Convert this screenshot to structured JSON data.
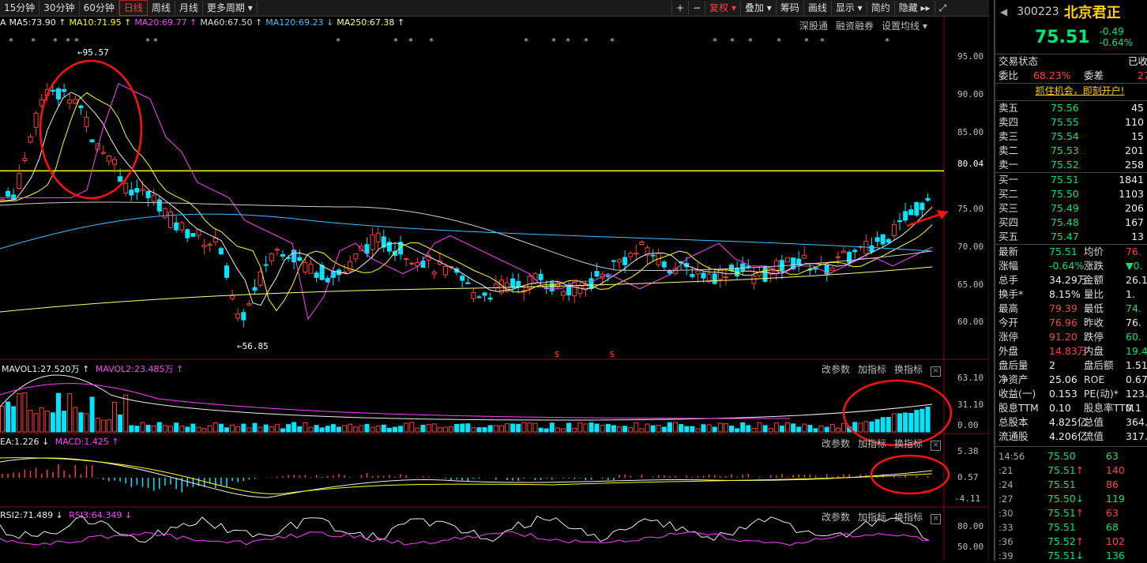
{
  "toolbar": {
    "periods": [
      "15分钟",
      "30分钟",
      "60分钟",
      "日线",
      "周线",
      "月线",
      "更多周期 ▾"
    ],
    "active": "日线",
    "right_items": [
      "+",
      "−",
      "复权 ▾",
      "叠加 ▾",
      "筹码",
      "画线",
      "显示 ▾",
      "简约",
      "隐藏 ▸▸"
    ]
  },
  "ma_legend": {
    "prefix": "A",
    "items": [
      {
        "text": "MA5:73.90 ↑",
        "color": "#eeeeee"
      },
      {
        "text": "MA10:71.95 ↑",
        "color": "#ffff00"
      },
      {
        "text": "MA20:69.77 ↑",
        "color": "#ff40ff"
      },
      {
        "text": "MA60:67.50 ↑",
        "color": "#dddddd"
      },
      {
        "text": "MA120:69.23 ↓",
        "color": "#40c0ff"
      },
      {
        "text": "MA250:67.38 ↑",
        "color": "#ffff80"
      }
    ],
    "links": [
      "深股通",
      "融资融券",
      "设置均线 ▾"
    ]
  },
  "price_chart": {
    "y_ticks": [
      "95.00",
      "90.00",
      "85.00",
      "80.04",
      "75.00",
      "70.00",
      "65.00",
      "60.00"
    ],
    "high_label": "95.57",
    "low_label": "56.85",
    "ref_line": 80.04
  },
  "volume_panel": {
    "title_1": "MAVOL1:27.520万 ↑",
    "title_2": "MAVOL2:23.485万 ↑",
    "links": [
      "改参数",
      "加指标",
      "换指标"
    ],
    "y_ticks": [
      "63.10",
      "31.10",
      "0.00"
    ]
  },
  "macd_panel": {
    "title_1": "EA:1.226 ↓",
    "title_2": "MACD:1.425 ↑",
    "links": [
      "改参数",
      "加指标",
      "换指标"
    ],
    "y_ticks": [
      "5.38",
      "0.57",
      "-4.11"
    ]
  },
  "rsi_panel": {
    "title_1": "RSI2:71.489 ↓",
    "title_2": "RSI3:64.349 ↓",
    "links": [
      "改参数",
      "加指标",
      "换指标"
    ],
    "y_ticks": [
      "80.00",
      "50.00"
    ]
  },
  "quote": {
    "code": "300223",
    "name": "北京君正",
    "price": "75.51",
    "change": "-0.49",
    "change_pct": "-0.64%",
    "status_label": "交易状态",
    "status_value": "已收",
    "weibi_label": "委比",
    "weibi_value": "68.23%",
    "weicha_label": "委差",
    "weicha_value": "27",
    "promo": "抓住机会，即刻开户!",
    "asks": [
      {
        "label": "卖五",
        "price": "75.56",
        "vol": "45"
      },
      {
        "label": "卖四",
        "price": "75.55",
        "vol": "110"
      },
      {
        "label": "卖三",
        "price": "75.54",
        "vol": "15"
      },
      {
        "label": "卖二",
        "price": "75.53",
        "vol": "201"
      },
      {
        "label": "卖一",
        "price": "75.52",
        "vol": "258"
      }
    ],
    "bids": [
      {
        "label": "买一",
        "price": "75.51",
        "vol": "1841"
      },
      {
        "label": "买二",
        "price": "75.50",
        "vol": "1103"
      },
      {
        "label": "买三",
        "price": "75.49",
        "vol": "206"
      },
      {
        "label": "买四",
        "price": "75.48",
        "vol": "167"
      },
      {
        "label": "买五",
        "price": "75.47",
        "vol": "13"
      }
    ],
    "stats": [
      {
        "l1": "最新",
        "v1": "75.51",
        "c1": "green",
        "l2": "均价",
        "v2": "76.",
        "c2": "redc"
      },
      {
        "l1": "涨幅",
        "v1": "-0.64%",
        "c1": "green",
        "l2": "涨跌",
        "v2": "▼0.",
        "c2": "green"
      },
      {
        "l1": "总手",
        "v1": "34.29万",
        "c1": "white",
        "l2": "金额",
        "v2": "26.18",
        "c2": "white"
      },
      {
        "l1": "换手*",
        "v1": "8.15%",
        "c1": "white",
        "l2": "量比",
        "v2": "1.",
        "c2": "white"
      },
      {
        "l1": "最高",
        "v1": "79.39",
        "c1": "redc",
        "l2": "最低",
        "v2": "74.",
        "c2": "green"
      },
      {
        "l1": "今开",
        "v1": "76.96",
        "c1": "redc",
        "l2": "昨收",
        "v2": "76.",
        "c2": "white"
      },
      {
        "l1": "涨停",
        "v1": "91.20",
        "c1": "redc",
        "l2": "跌停",
        "v2": "60.",
        "c2": "green"
      },
      {
        "l1": "外盘",
        "v1": "14.83万",
        "c1": "redc",
        "l2": "内盘",
        "v2": "19.46",
        "c2": "green"
      },
      {
        "l1": "盘后量",
        "v1": "2",
        "c1": "white",
        "l2": "盘后额",
        "v2": "1.51",
        "c2": "white"
      },
      {
        "l1": "净资产",
        "v1": "25.06",
        "c1": "white",
        "l2": "ROE",
        "v2": "0.67",
        "c2": "white"
      },
      {
        "l1": "收益(一)",
        "v1": "0.153",
        "c1": "white",
        "l2": "PE(动)*",
        "v2": "123.",
        "c2": "white"
      },
      {
        "l1": "股息TTM",
        "v1": "0.10",
        "c1": "white",
        "l2": "股息率TTM",
        "v2": "0.1",
        "c2": "white"
      },
      {
        "l1": "总股本",
        "v1": "4.825亿",
        "c1": "white",
        "l2": "总值",
        "v2": "364.4",
        "c2": "white"
      },
      {
        "l1": "流通股",
        "v1": "4.206亿",
        "c1": "white",
        "l2": "流值",
        "v2": "317.6",
        "c2": "white"
      }
    ],
    "ticks": [
      {
        "time": "14:56",
        "price": "75.50",
        "vol": "63",
        "pc": "green",
        "vc": "green",
        "arrow": ""
      },
      {
        "time": ":21",
        "price": "75.51",
        "vol": "140",
        "pc": "green",
        "vc": "redc",
        "arrow": "↑"
      },
      {
        "time": ":24",
        "price": "75.51",
        "vol": "86",
        "pc": "green",
        "vc": "redc",
        "arrow": ""
      },
      {
        "time": ":27",
        "price": "75.50",
        "vol": "119",
        "pc": "green",
        "vc": "green",
        "arrow": "↓"
      },
      {
        "time": ":30",
        "price": "75.51",
        "vol": "63",
        "pc": "green",
        "vc": "redc",
        "arrow": "↑"
      },
      {
        "time": ":33",
        "price": "75.51",
        "vol": "68",
        "pc": "green",
        "vc": "green",
        "arrow": ""
      },
      {
        "time": ":36",
        "price": "75.52",
        "vol": "102",
        "pc": "green",
        "vc": "redc",
        "arrow": "↑"
      },
      {
        "time": ":39",
        "price": "75.51",
        "vol": "136",
        "pc": "green",
        "vc": "green",
        "arrow": "↓"
      }
    ]
  }
}
